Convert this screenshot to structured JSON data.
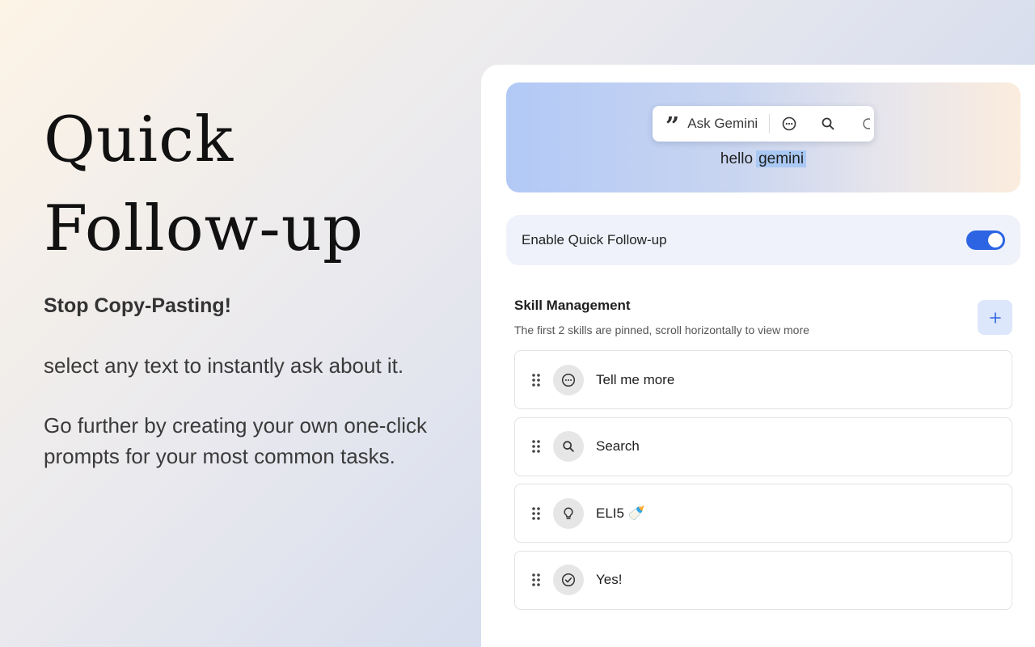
{
  "hero": {
    "title_line1": "Quick",
    "title_line2": "Follow-up",
    "subtitle": "Stop Copy-Pasting!",
    "paragraph1": "select any text to instantly ask about it.",
    "paragraph2": "Go further by creating your own one-click prompts for your most common tasks."
  },
  "preview": {
    "toolbar": {
      "quote_glyph": "”",
      "ask_label": "Ask Gemini",
      "icons": [
        "chat-bubble-icon",
        "search-icon",
        "more-icon"
      ]
    },
    "text_plain": "hello",
    "text_selected": "gemini"
  },
  "settings": {
    "toggle_label": "Enable Quick Follow-up",
    "toggle_on": true,
    "accent_color": "#2c64e3"
  },
  "skills": {
    "title": "Skill Management",
    "description": "The first 2 skills are pinned, scroll horizontally to view more",
    "add_label": "+",
    "items": [
      {
        "label": "Tell me more",
        "icon": "chat-bubble-icon"
      },
      {
        "label": "Search",
        "icon": "search-icon"
      },
      {
        "label": "ELI5 🍼",
        "icon": "lightbulb-icon"
      },
      {
        "label": "Yes!",
        "icon": "check-circle-icon"
      }
    ]
  }
}
